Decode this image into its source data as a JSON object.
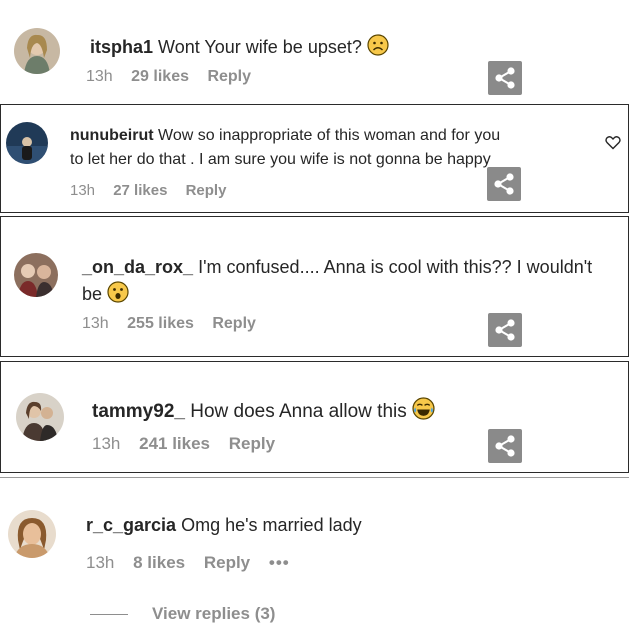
{
  "comments": [
    {
      "username": "itspha1",
      "text": "Wont Your wife be upset?",
      "emoji": "frowning-face",
      "time": "13h",
      "likes": "29 likes",
      "reply": "Reply"
    },
    {
      "username": "nunubeirut",
      "text_line1": "Wow so inappropriate of this woman and for you",
      "text_line2": "to let her do that . I am sure you wife is not gonna be happy",
      "time": "13h",
      "likes": "27 likes",
      "reply": "Reply"
    },
    {
      "username": "_on_da_rox_",
      "text_line1": "I'm confused.... Anna is cool with this?? I wouldn't",
      "text_line2": "be",
      "emoji": "astonished-face",
      "time": "13h",
      "likes": "255 likes",
      "reply": "Reply"
    },
    {
      "username": "tammy92_",
      "text": "How does Anna allow this",
      "emoji": "tears-of-joy-face",
      "time": "13h",
      "likes": "241 likes",
      "reply": "Reply"
    },
    {
      "username": "r_c_garcia",
      "text": "Omg he's married lady",
      "time": "13h",
      "likes": "8 likes",
      "reply": "Reply",
      "more": "•••",
      "view_replies": "View replies (3)"
    }
  ],
  "colors": {
    "text": "#262626",
    "meta": "#8e8e8e",
    "share_bg": "#8a8a8a",
    "border": "#2b2b2b"
  },
  "icons": [
    "share-icon",
    "heart-icon",
    "more-options-icon"
  ]
}
